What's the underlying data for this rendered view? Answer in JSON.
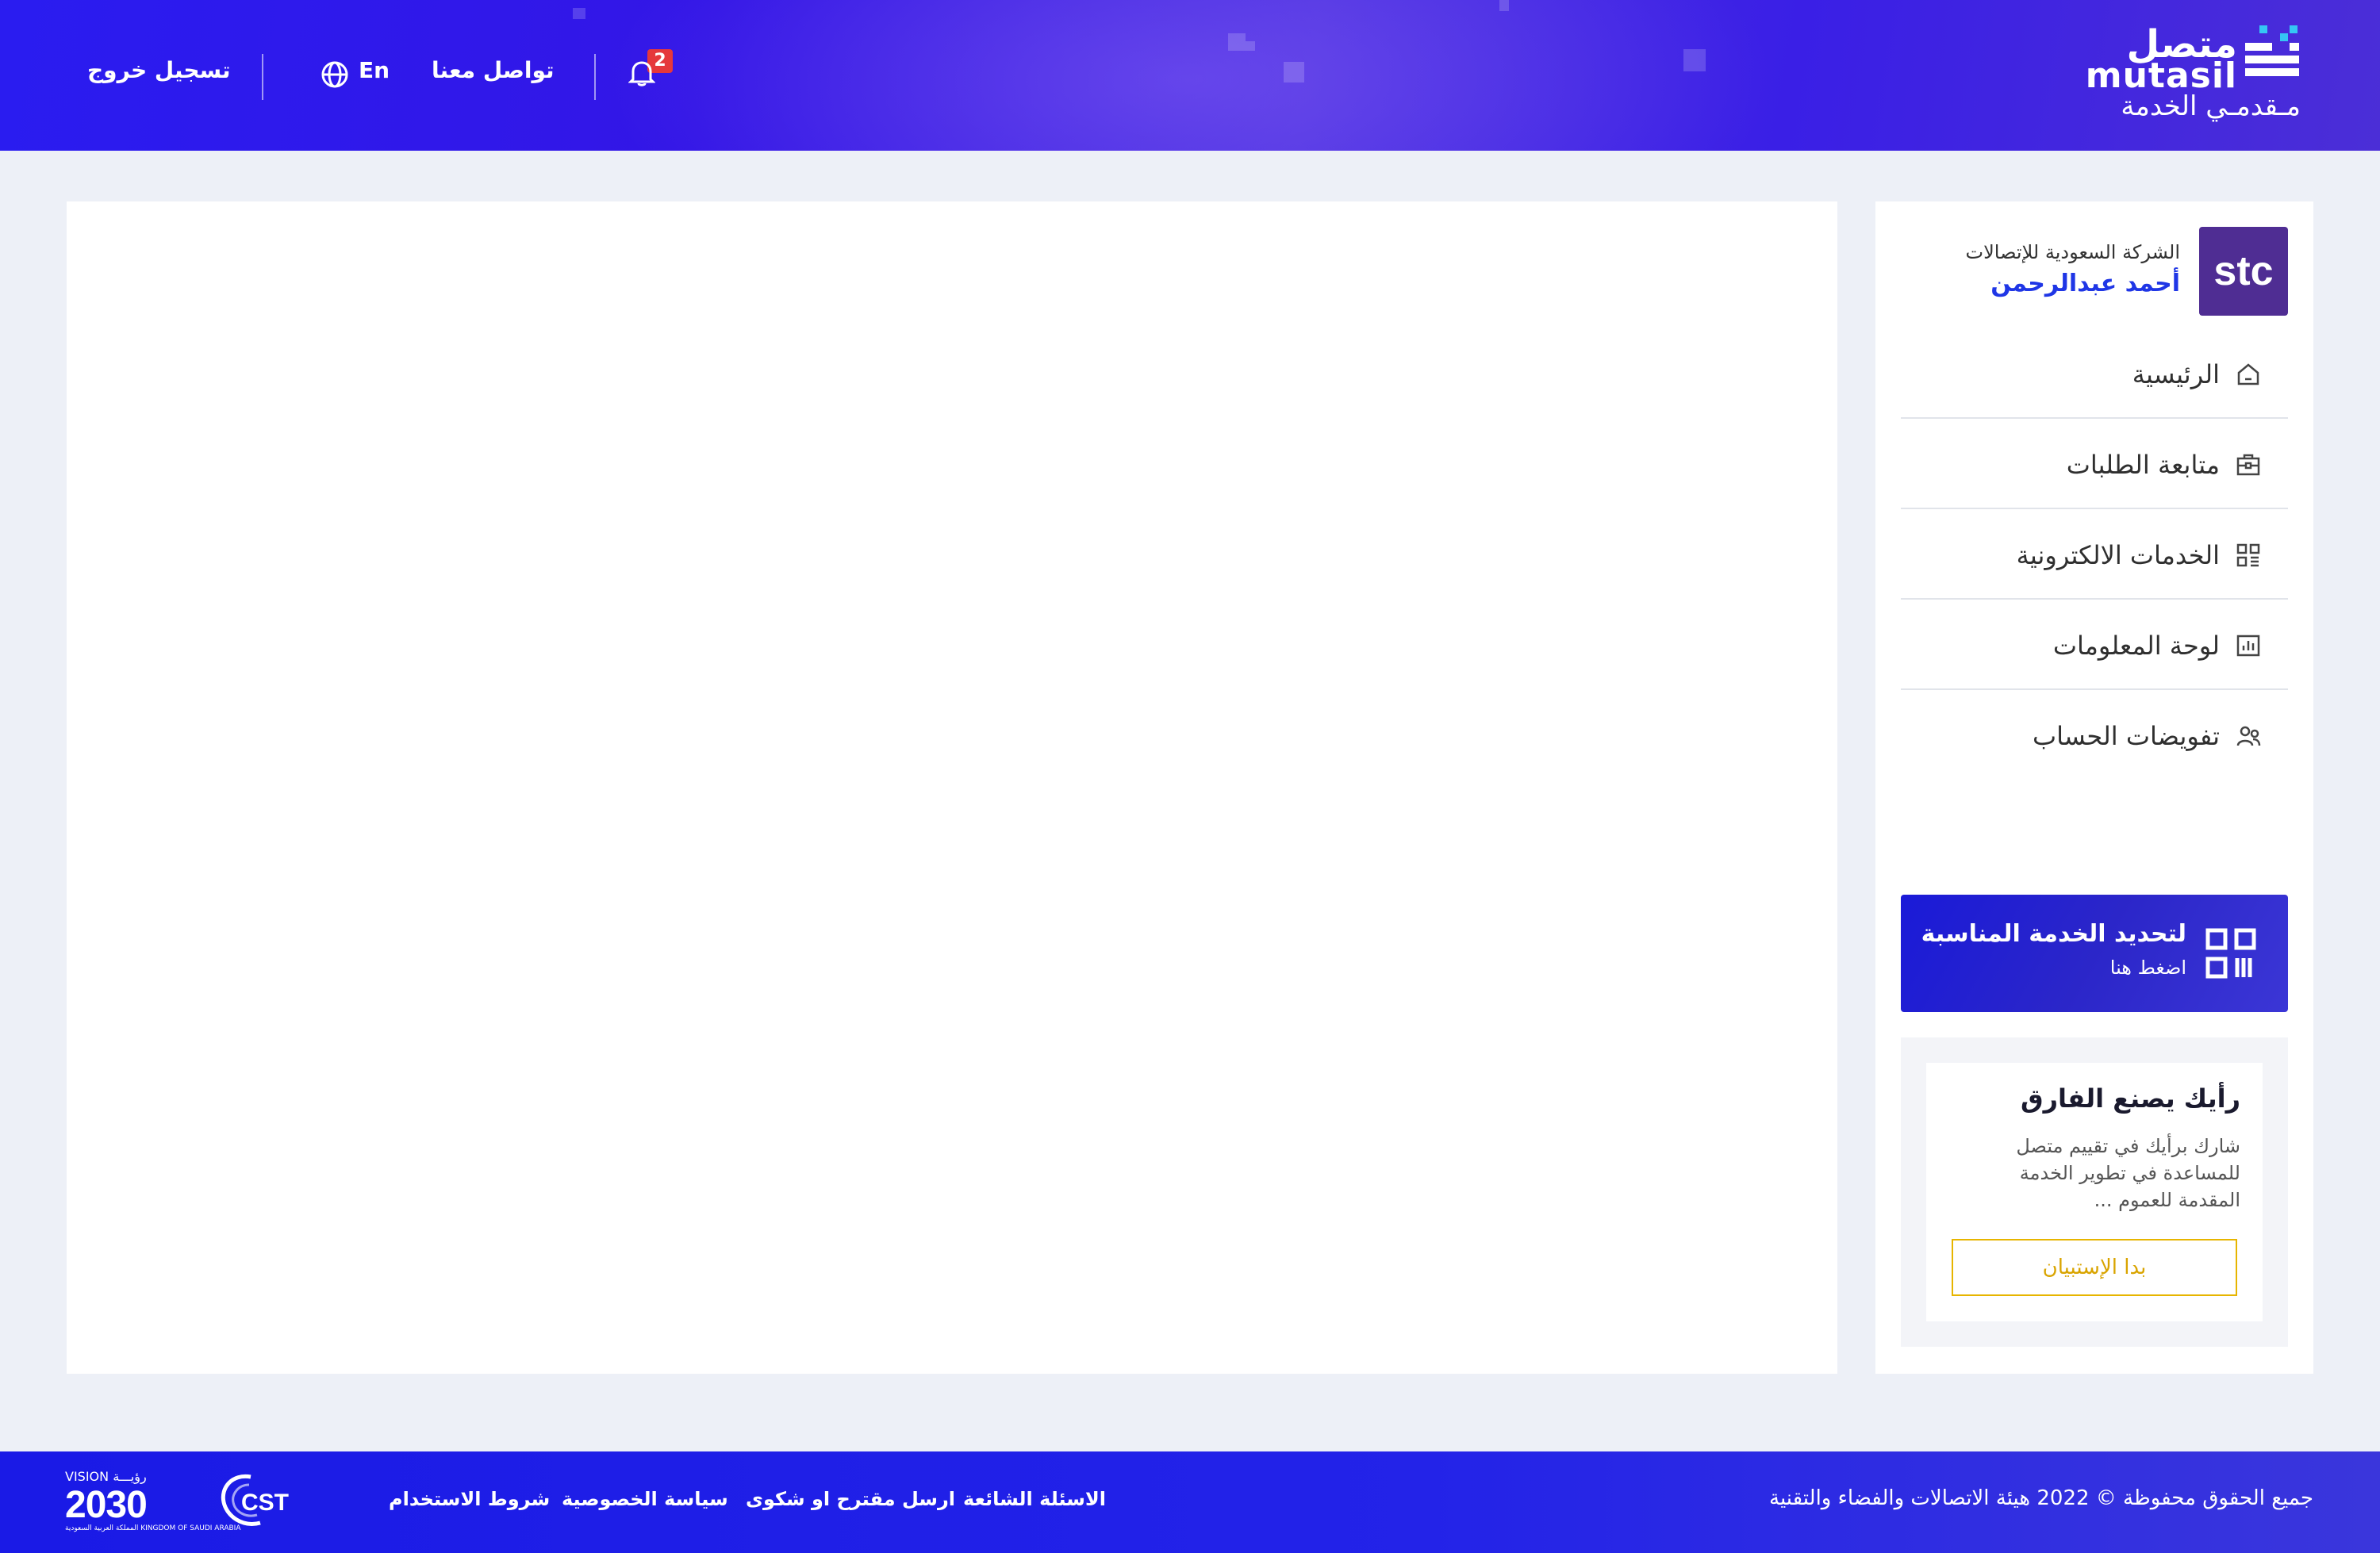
{
  "header": {
    "logo": {
      "name_ar": "متصل",
      "name_en": "mutasil",
      "tagline": "مـقدمـي الخدمة"
    },
    "notifications": {
      "count": "2",
      "icon": "bell-icon"
    },
    "contact_label": "تواصل معنا",
    "language_label": "En",
    "language_icon": "globe-icon",
    "logout_label": "تسجيل خروج"
  },
  "sidebar": {
    "company_logo_text": "stc",
    "company_logo_color": "#4f2d93",
    "company_name": "الشركة السعودية للإتصالات",
    "user_name": "أحمد عبدالرحمن",
    "nav": [
      {
        "label": "الرئيسية",
        "icon": "home-icon"
      },
      {
        "label": "متابعة الطلبات",
        "icon": "briefcase-icon"
      },
      {
        "label": "الخدمات الالكترونية",
        "icon": "grid-icon"
      },
      {
        "label": "لوحة المعلومات",
        "icon": "chart-icon"
      },
      {
        "label": "تفويضات الحساب",
        "icon": "users-icon"
      }
    ],
    "service_banner": {
      "title": "لتحديد الخدمة المناسبة",
      "subtitle": "اضغط هنا",
      "icon": "qr-grid-icon"
    },
    "survey": {
      "title": "رأيك يصنع الفارق",
      "text": "شارك برأيك في تقييم متصل للمساعدة في تطوير الخدمة المقدمة للعموم ...",
      "button_label": "بدا الإستبيان",
      "button_color": "#e7b500"
    }
  },
  "footer": {
    "copyright": "جميع الحقوق محفوظة © 2022 هيئة الاتصالات والفضاء والتقنية",
    "links": [
      "الاسئلة الشائعة",
      "ارسل مقترح او شكوى",
      "سياسة الخصوصية",
      "شروط الاستخدام"
    ],
    "cst_logo_text": "CST",
    "vision_top": "VISION رؤيـــة",
    "vision_number": "2030",
    "vision_sub": "المملكة العربية السعودية KINGDOM OF SAUDI ARABIA"
  },
  "colors": {
    "header_blue": "#2a1cf0",
    "accent_blue": "#1f36e6",
    "badge_red": "#e5383b",
    "page_bg": "#edf0f7"
  }
}
